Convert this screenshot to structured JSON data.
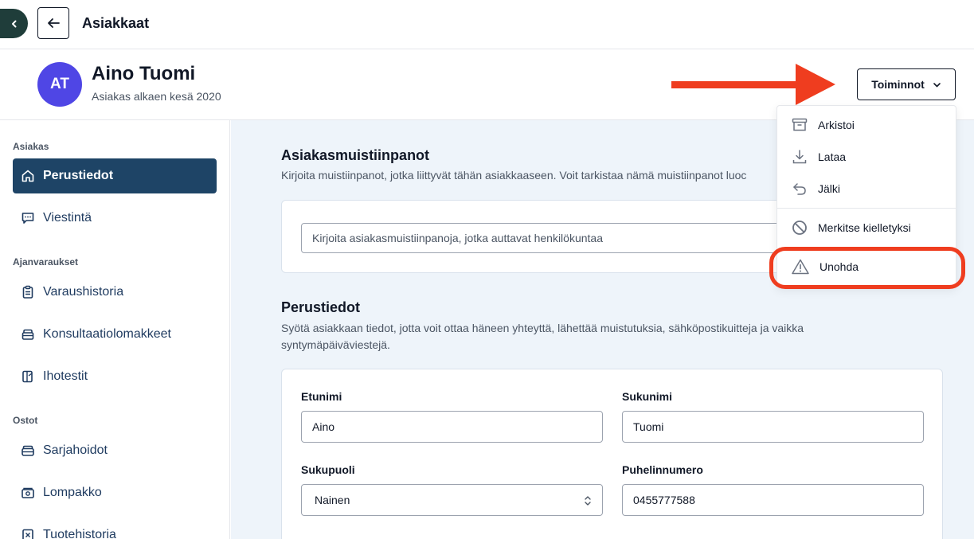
{
  "topbar": {
    "title": "Asiakkaat"
  },
  "header": {
    "avatar_initials": "AT",
    "name": "Aino Tuomi",
    "since": "Asiakas alkaen kesä 2020",
    "actions_label": "Toiminnot"
  },
  "sidebar": {
    "sections": [
      "Asiakas",
      "Ajanvaraukset",
      "Ostot"
    ],
    "items": [
      {
        "label": "Perustiedot",
        "icon": "home-icon",
        "active": true
      },
      {
        "label": "Viestintä",
        "icon": "chat-icon"
      },
      {
        "label": "Varaushistoria",
        "icon": "clipboard-icon"
      },
      {
        "label": "Konsultaatiolomakkeet",
        "icon": "layers-icon"
      },
      {
        "label": "Ihotestit",
        "icon": "skin-test-icon"
      },
      {
        "label": "Sarjahoidot",
        "icon": "stack-icon"
      },
      {
        "label": "Lompakko",
        "icon": "wallet-icon"
      },
      {
        "label": "Tuotehistoria",
        "icon": "receipt-icon"
      }
    ]
  },
  "notes": {
    "title": "Asiakasmuistiinpanot",
    "description": "Kirjoita muistiinpanot, jotka liittyvät tähän asiakkaaseen. Voit tarkistaa nämä muistiinpanot luoc",
    "placeholder": "Kirjoita asiakasmuistiinpanoja, jotka auttavat henkilökuntaa"
  },
  "basic_info": {
    "title": "Perustiedot",
    "description_line1": "Syötä asiakkaan tiedot, jotta voit ottaa häneen yhteyttä, lähettää muistutuksia, sähköpostikuitteja ja vaikka",
    "description_line2": "syntymäpäiväviestejä.",
    "fields": {
      "first_name": {
        "label": "Etunimi",
        "value": "Aino"
      },
      "last_name": {
        "label": "Sukunimi",
        "value": "Tuomi"
      },
      "gender": {
        "label": "Sukupuoli",
        "value": "Nainen"
      },
      "phone": {
        "label": "Puhelinnumero",
        "value": "0455777588"
      }
    }
  },
  "dropdown": {
    "items": [
      {
        "label": "Arkistoi",
        "icon": "archive-icon"
      },
      {
        "label": "Lataa",
        "icon": "download-icon"
      },
      {
        "label": "Jälki",
        "icon": "undo-icon"
      },
      {
        "label": "Merkitse kielletyksi",
        "icon": "ban-icon"
      },
      {
        "label": "Unohda",
        "icon": "warning-icon"
      }
    ]
  },
  "colors": {
    "accent": "#1e4466",
    "avatar": "#4f46e5",
    "annotation": "#ef3d1f",
    "main_bg": "#eef4fa"
  }
}
